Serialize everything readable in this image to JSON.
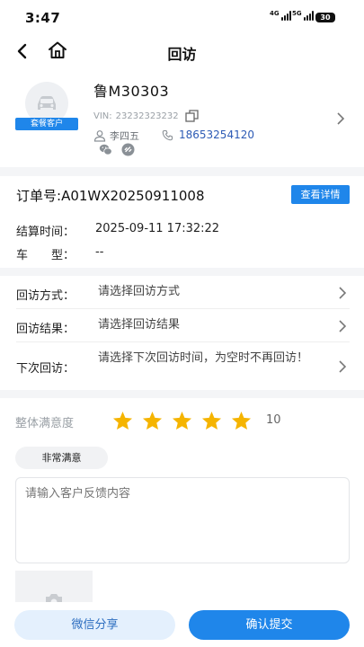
{
  "status": {
    "time": "3:47",
    "net1": "4G",
    "net2": "5G",
    "battery": "30"
  },
  "nav": {
    "title": "回访",
    "back_icon": "chevron-left-icon",
    "home_icon": "home-icon"
  },
  "vehicle": {
    "badge": "套餐客户",
    "plate": "鲁M30303",
    "vin_label": "VIN:",
    "vin": "23232323232",
    "owner": "李四五",
    "phone": "18653254120"
  },
  "order": {
    "label": "订单号:",
    "number": "A01WX20250911008",
    "detail_button": "查看详情",
    "settle_label": "结算时间：",
    "settle_time": "2025-09-11 17:32:22",
    "model_label": "车　　型：",
    "model_value": "--"
  },
  "visit": {
    "method_label": "回访方式：",
    "method_placeholder": "请选择回访方式",
    "result_label": "回访结果：",
    "result_placeholder": "请选择回访结果",
    "next_label": "下次回访：",
    "next_placeholder": "请选择下次回访时间，为空时不再回访！"
  },
  "rating": {
    "label": "整体满意度",
    "stars": 5,
    "score": "10",
    "tag": "非常满意",
    "feedback_placeholder": "请输入客户反馈内容"
  },
  "footer": {
    "share_button": "微信分享",
    "submit_button": "确认提交"
  },
  "colors": {
    "accent": "#1f86ea",
    "star": "#f5b400",
    "phone": "#2d5bb5"
  }
}
